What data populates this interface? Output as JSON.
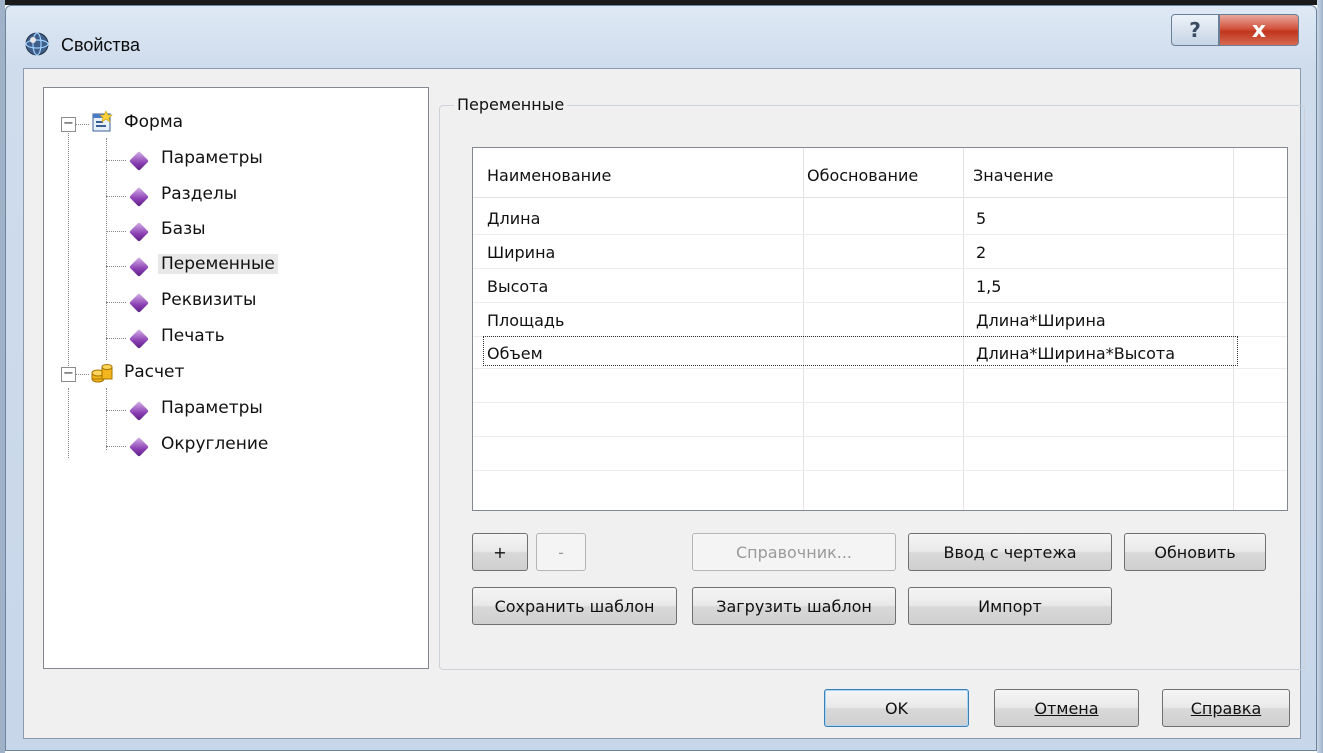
{
  "window": {
    "title": "Свойства",
    "help_glyph": "?",
    "close_glyph": "x"
  },
  "tree": {
    "root_forma": {
      "label": "Форма",
      "expander": "−"
    },
    "forma_items": [
      "Параметры",
      "Разделы",
      "Базы",
      "Переменные",
      "Реквизиты",
      "Печать"
    ],
    "selected_item": "Переменные",
    "root_raschet": {
      "label": "Расчет",
      "expander": "−"
    },
    "raschet_items": [
      "Параметры",
      "Округление"
    ]
  },
  "group": {
    "title": "Переменные"
  },
  "grid": {
    "columns": [
      "Наименование",
      "Обоснование",
      "Значение"
    ],
    "rows": [
      {
        "name": "Длина",
        "basis": "",
        "value": "5"
      },
      {
        "name": "Ширина",
        "basis": "",
        "value": "2"
      },
      {
        "name": "Высота",
        "basis": "",
        "value": "1,5"
      },
      {
        "name": "Площадь",
        "basis": "",
        "value": "Длина*Ширина"
      },
      {
        "name": "Объем",
        "basis": "",
        "value": "Длина*Ширина*Высота"
      }
    ]
  },
  "buttons": {
    "add": "+",
    "remove": "-",
    "reference": "Справочник...",
    "input_from_drawing": "Ввод с чертежа",
    "refresh": "Обновить",
    "save_template": "Сохранить шаблон",
    "load_template": "Загрузить шаблон",
    "import": "Импорт",
    "ok": "OK",
    "cancel": "Отмена",
    "help": "Справка"
  },
  "colors": {
    "accent_bullet": "#8a3fb3",
    "close_button": "#c0351e",
    "title_bar": "#cfdcec"
  }
}
